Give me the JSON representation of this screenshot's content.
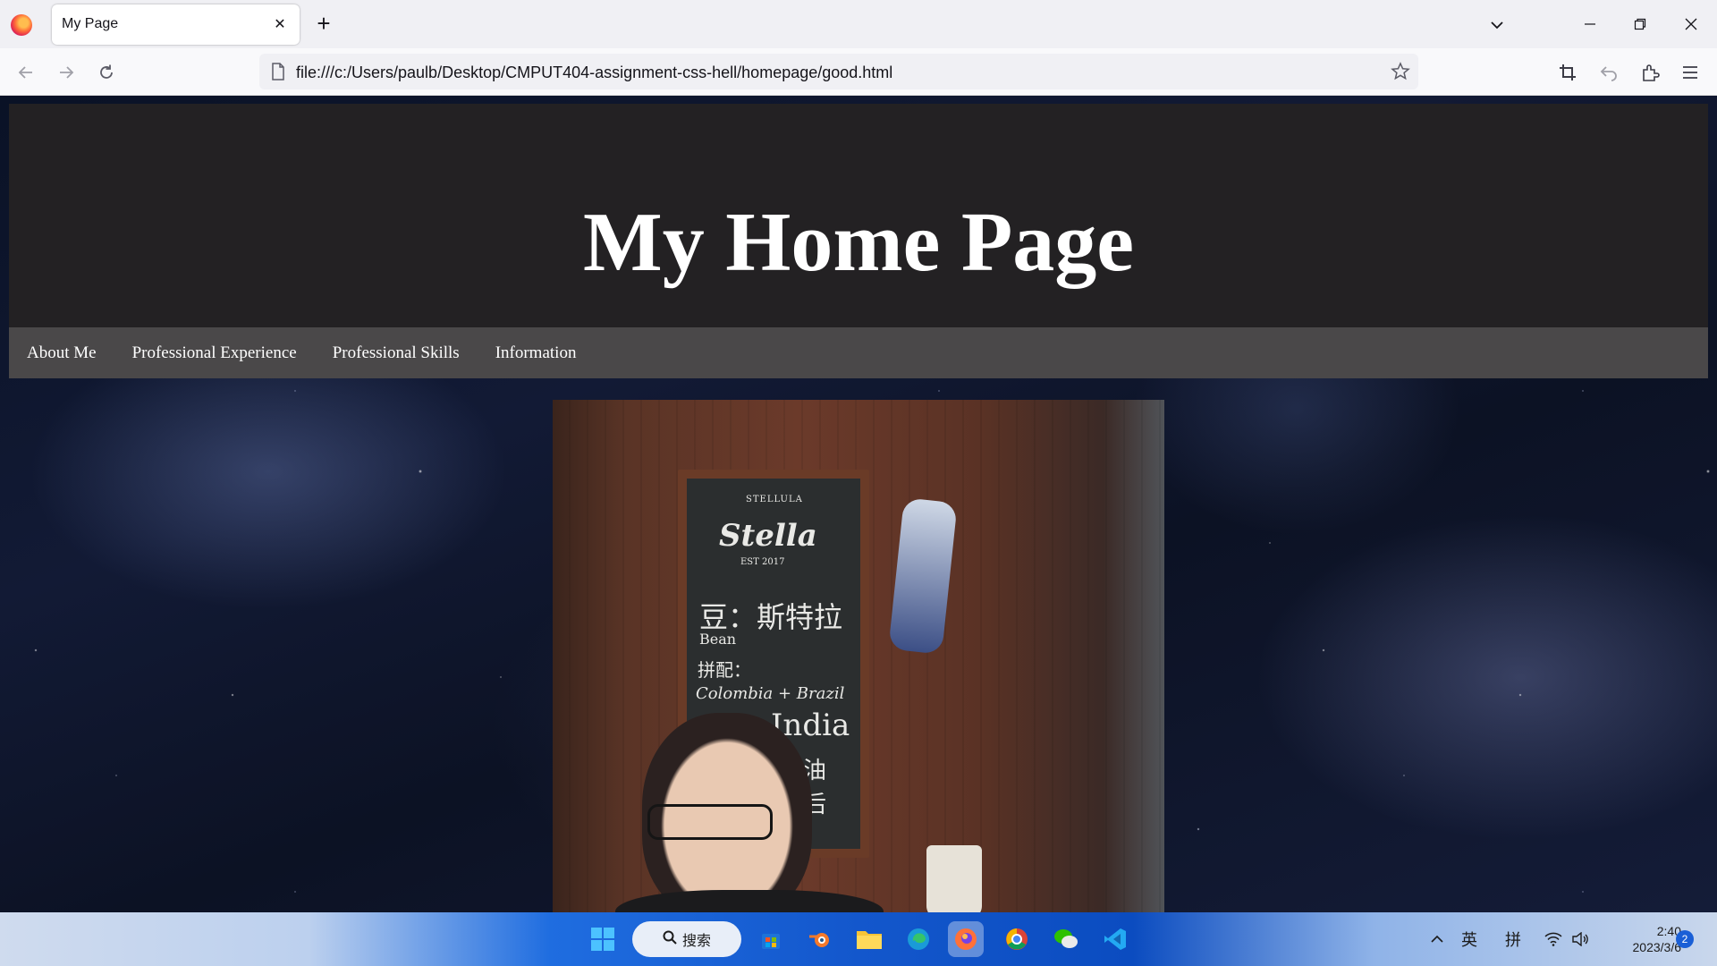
{
  "browser": {
    "tab_title": "My Page",
    "tab_close": "✕",
    "new_tab": "+",
    "url": "file:///c:/Users/paulb/Desktop/CMPUT404-assignment-css-hell/homepage/good.html"
  },
  "page": {
    "title": "My Home Page",
    "nav": [
      "About Me",
      "Professional Experience",
      "Professional Skills",
      "Information"
    ]
  },
  "photo": {
    "chalk_lines": [
      "STELLULA",
      "Stella",
      "EST 2017",
      "豆：斯特拉",
      "Bean",
      "拼配：",
      "Colombia + Brazil",
      "India",
      "奶油",
      "午后"
    ]
  },
  "taskbar": {
    "search_label": "搜索",
    "ime_lang": "英",
    "ime_mode": "拼",
    "time": "2:40",
    "date": "2023/3/6",
    "notification_count": "2"
  },
  "colors": {
    "header_bg": "#232123",
    "nav_bg": "#4a4849",
    "accent": "#1a5fd6"
  }
}
